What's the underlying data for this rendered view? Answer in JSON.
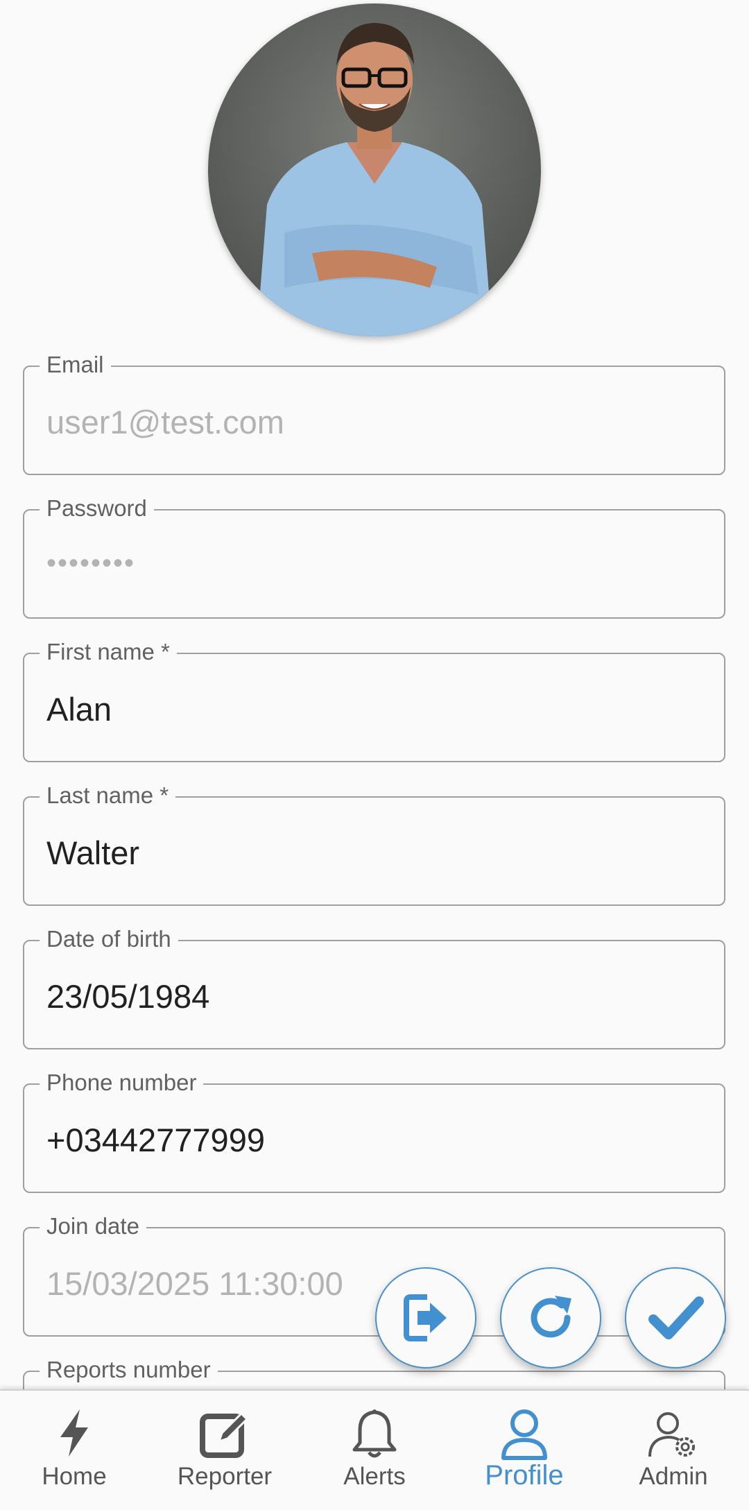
{
  "profile": {
    "avatar_alt": "profile photo"
  },
  "fields": [
    {
      "label": "Email",
      "value": "user1@test.com",
      "disabled": true
    },
    {
      "label": "Password",
      "value": "••••••••",
      "disabled": true
    },
    {
      "label": "First name *",
      "value": "Alan",
      "disabled": false
    },
    {
      "label": "Last name *",
      "value": "Walter",
      "disabled": false
    },
    {
      "label": "Date of birth",
      "value": "23/05/1984",
      "disabled": false
    },
    {
      "label": "Phone number",
      "value": "+03442777999",
      "disabled": false
    },
    {
      "label": "Join date",
      "value": "15/03/2025 11:30:00",
      "disabled": true
    },
    {
      "label": "Reports number",
      "value": "",
      "disabled": true
    }
  ],
  "actions": {
    "logout_icon": "logout-icon",
    "refresh_icon": "refresh-icon",
    "save_icon": "check-icon"
  },
  "nav": {
    "items": [
      {
        "label": "Home",
        "icon": "lightning-icon"
      },
      {
        "label": "Reporter",
        "icon": "edit-icon"
      },
      {
        "label": "Alerts",
        "icon": "bell-icon"
      },
      {
        "label": "Profile",
        "icon": "user-icon",
        "active": true
      },
      {
        "label": "Admin",
        "icon": "admin-settings-icon"
      }
    ]
  },
  "colors": {
    "accent": "#4290d0",
    "border": "#9e9e9e",
    "background": "#fafafa"
  }
}
